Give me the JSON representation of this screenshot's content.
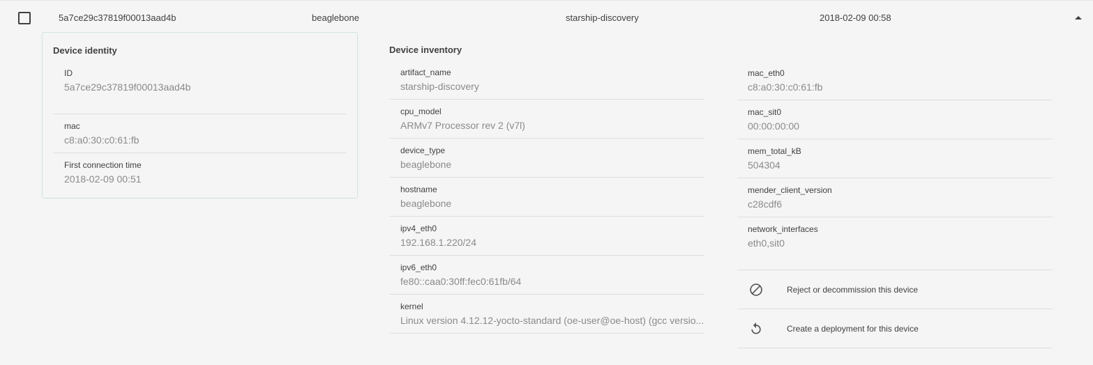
{
  "row": {
    "device_id": "5a7ce29c37819f00013aad4b",
    "device_type": "beaglebone",
    "artifact": "starship-discovery",
    "last_checkin": "2018-02-09 00:58"
  },
  "identity": {
    "title": "Device identity",
    "fields": [
      {
        "label": "ID",
        "value": "5a7ce29c37819f00013aad4b"
      },
      {
        "label": "mac",
        "value": "c8:a0:30:c0:61:fb"
      },
      {
        "label": "First connection time",
        "value": "2018-02-09 00:51"
      }
    ]
  },
  "inventory": {
    "title": "Device inventory",
    "left": [
      {
        "label": "artifact_name",
        "value": "starship-discovery"
      },
      {
        "label": "cpu_model",
        "value": "ARMv7 Processor rev 2 (v7l)"
      },
      {
        "label": "device_type",
        "value": "beaglebone"
      },
      {
        "label": "hostname",
        "value": "beaglebone"
      },
      {
        "label": "ipv4_eth0",
        "value": "192.168.1.220/24"
      },
      {
        "label": "ipv6_eth0",
        "value": "fe80::caa0:30ff:fec0:61fb/64"
      },
      {
        "label": "kernel",
        "value": "Linux version 4.12.12-yocto-standard (oe-user@oe-host) (gcc versio..."
      }
    ],
    "right": [
      {
        "label": "mac_eth0",
        "value": "c8:a0:30:c0:61:fb"
      },
      {
        "label": "mac_sit0",
        "value": "00:00:00:00"
      },
      {
        "label": "mem_total_kB",
        "value": "504304"
      },
      {
        "label": "mender_client_version",
        "value": "c28cdf6"
      },
      {
        "label": "network_interfaces",
        "value": "eth0,sit0"
      }
    ]
  },
  "actions": [
    {
      "label": "Reject or decommission this device",
      "icon": "block-icon"
    },
    {
      "label": "Create a deployment for this device",
      "icon": "replay-icon"
    }
  ]
}
